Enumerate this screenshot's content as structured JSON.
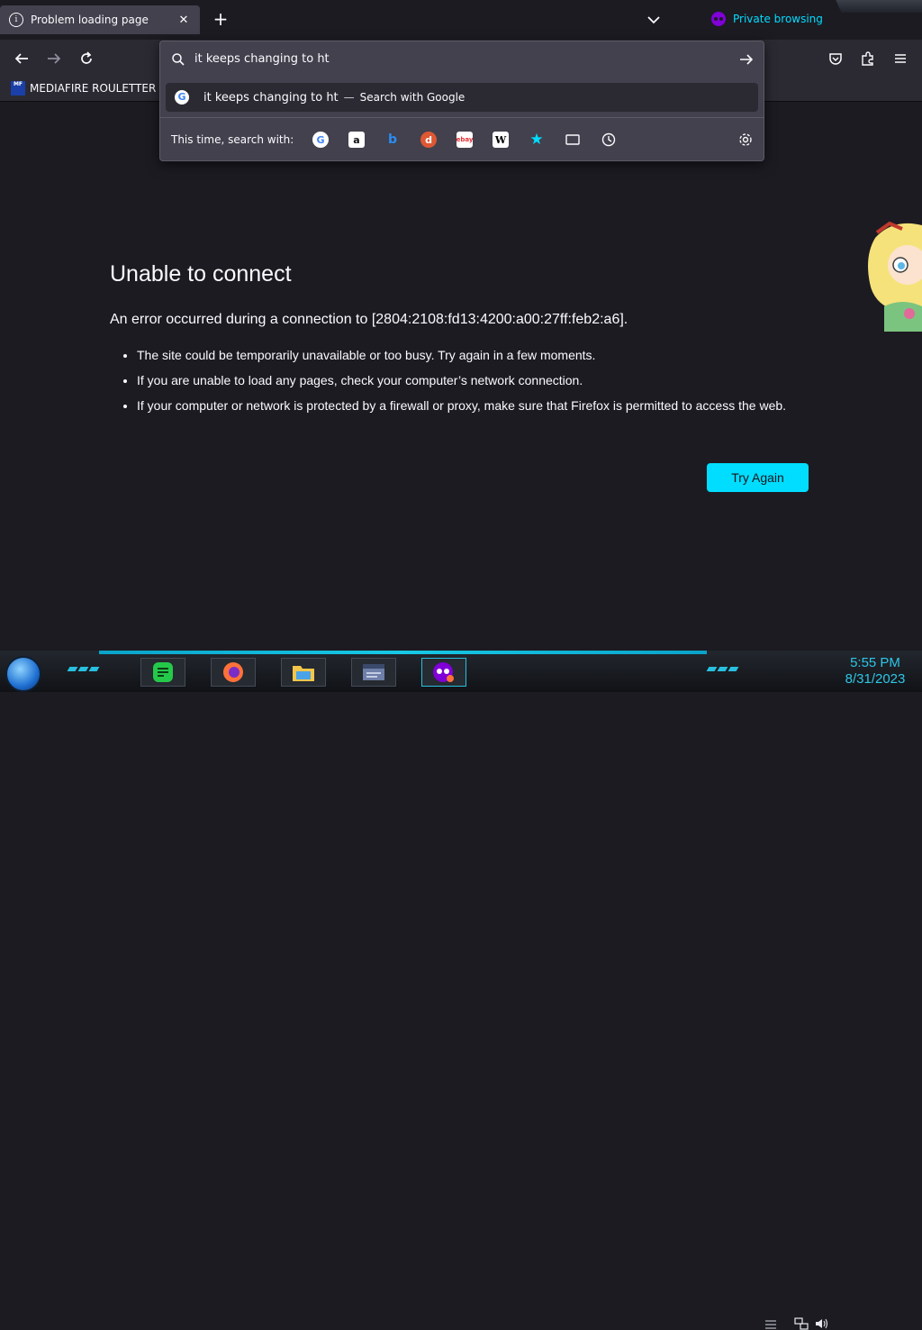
{
  "tab": {
    "title": "Problem loading page",
    "close": "✕"
  },
  "tabstrip": {
    "new_tab": "+",
    "private_label": "Private browsing"
  },
  "bookmarks": {
    "items": [
      {
        "label": "MEDIAFIRE ROULETTER",
        "favicon_text": "MF"
      }
    ]
  },
  "urlbar": {
    "value": "it keeps changing to ht",
    "suggestion": {
      "query": "it keeps changing to ht",
      "separator": "—",
      "action": "Search with Google"
    },
    "search_with_label": "This time, search with:",
    "engines": [
      "google-icon",
      "amazon-icon",
      "bing-icon",
      "duckduckgo-icon",
      "ebay-icon",
      "wikipedia-icon",
      "bookmarks-star-icon",
      "tabs-icon",
      "history-icon"
    ]
  },
  "error": {
    "title": "Unable to connect",
    "lead": "An error occurred during a connection to [2804:2108:fd13:4200:a00:27ff:feb2:a6].",
    "items": [
      "The site could be temporarily unavailable or too busy. Try again in a few moments.",
      "If you are unable to load any pages, check your computer’s network connection.",
      "If your computer or network is protected by a firewall or proxy, make sure that Firefox is permitted to access the web."
    ],
    "button": "Try Again"
  },
  "taskbar": {
    "time": "5:55 PM",
    "date": "8/31/2023"
  },
  "colors": {
    "accent": "#00ddff",
    "page_bg": "#1c1b22",
    "toolbar": "#2b2a33",
    "panel": "#42414d",
    "private": "#8000d7"
  }
}
